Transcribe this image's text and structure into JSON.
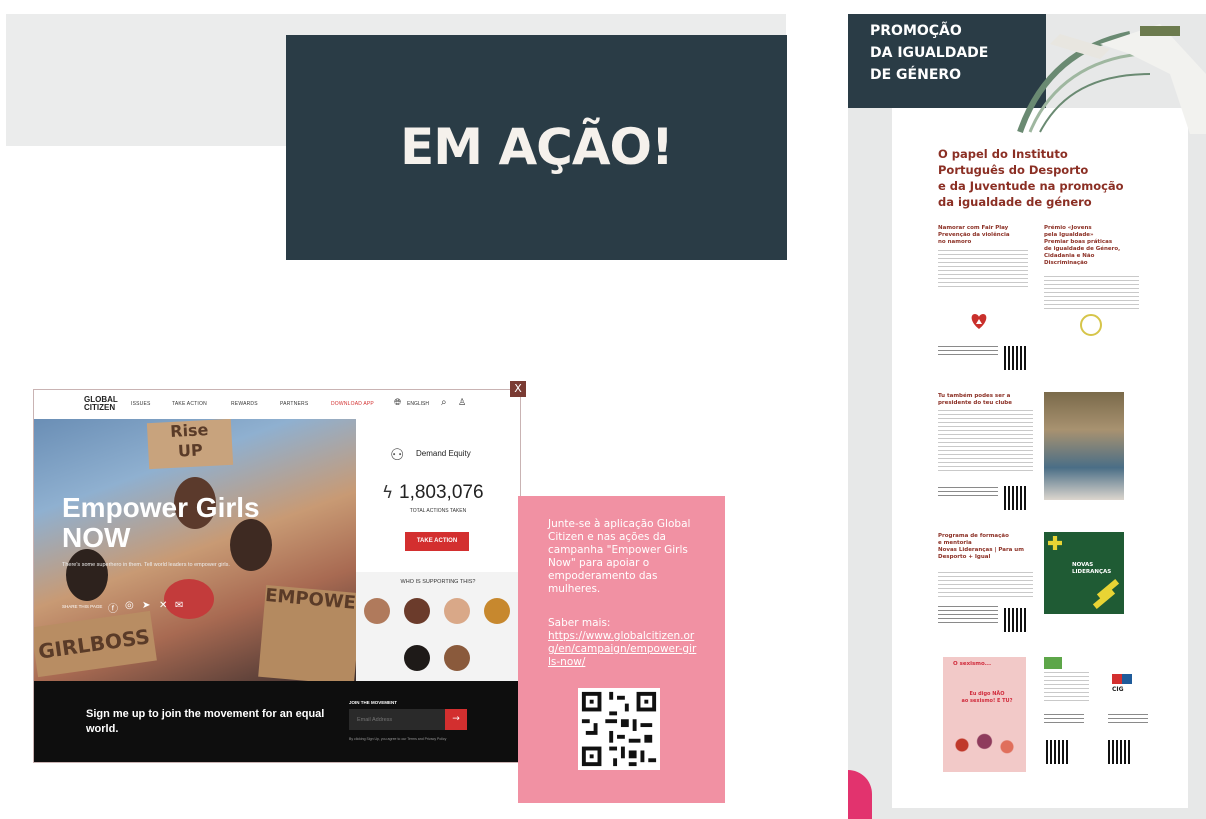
{
  "hero": {
    "title": "EM AÇÃO!"
  },
  "browser": {
    "close_label": "X",
    "logo_line1": "GLOBAL",
    "logo_line2": "CITIZEN",
    "nav": [
      "ISSUES",
      "TAKE ACTION",
      "REWARDS",
      "PARTNERS",
      "DOWNLOAD APP"
    ],
    "language": "ENGLISH",
    "headline_line1": "Empower Girls",
    "headline_line2": "NOW",
    "subline": "There's some superhero in them. Tell world leaders to empower girls.",
    "share_label": "SHARE THIS PAGE",
    "campaign_title": "Demand Equity",
    "actions_count": "1,803,076",
    "actions_label": "TOTAL ACTIONS TAKEN",
    "take_action": "TAKE ACTION",
    "supporters_label": "WHO IS SUPPORTING THIS?",
    "footer_text": "Sign me up to join the movement for an equal world.",
    "join_label": "JOIN THE MOVEMENT",
    "email_placeholder": "Email Address",
    "legal": "By clicking Sign Up, you agree to our Terms and Privacy Policy",
    "colors": {
      "accent": "#d32f2f",
      "footer": "#0e0e0e"
    }
  },
  "pink_card": {
    "text": "Junte-se à aplicação Global Citizen e nas ações da campanha \"Empower Girls Now\" para apoiar o empoderamento das mulheres.",
    "more_label": "Saber mais:",
    "link": "https://www.globalcitizen.org/en/campaign/empower-girls-now/",
    "color": "#f191a3"
  },
  "poster": {
    "title": "PROMOÇÃO\nDA IGUALDADE\nDE GÉNERO",
    "heading": "O papel do Instituto\nPortuguês do Desporto\ne da Juventude na promoção\nda igualdade de género",
    "sections": [
      {
        "title": "Namorar com Fair Play\nPrevenção da violência\nno namoro"
      },
      {
        "title": "Prémio «Jovens\npela Igualdade»\nPremiar boas práticas\nde igualdade de Género,\nCidadania e Não\nDiscriminação"
      },
      {
        "title": "Tu também podes ser a\npresidente do teu clube"
      },
      {
        "title": "Programa de formação\ne mentoria\nNovas Lideranças | Para um\nDesporto + Igual"
      }
    ],
    "novas_liderancas": "NOVAS\nLIDERANÇAS",
    "cig": "CIG",
    "sexismo_title": "O sexismo...",
    "sexismo_text": "Eu digo NÃO\nao sexismo! E TU?",
    "color_primary": "#2a3c46",
    "color_heading": "#8b2f24"
  }
}
